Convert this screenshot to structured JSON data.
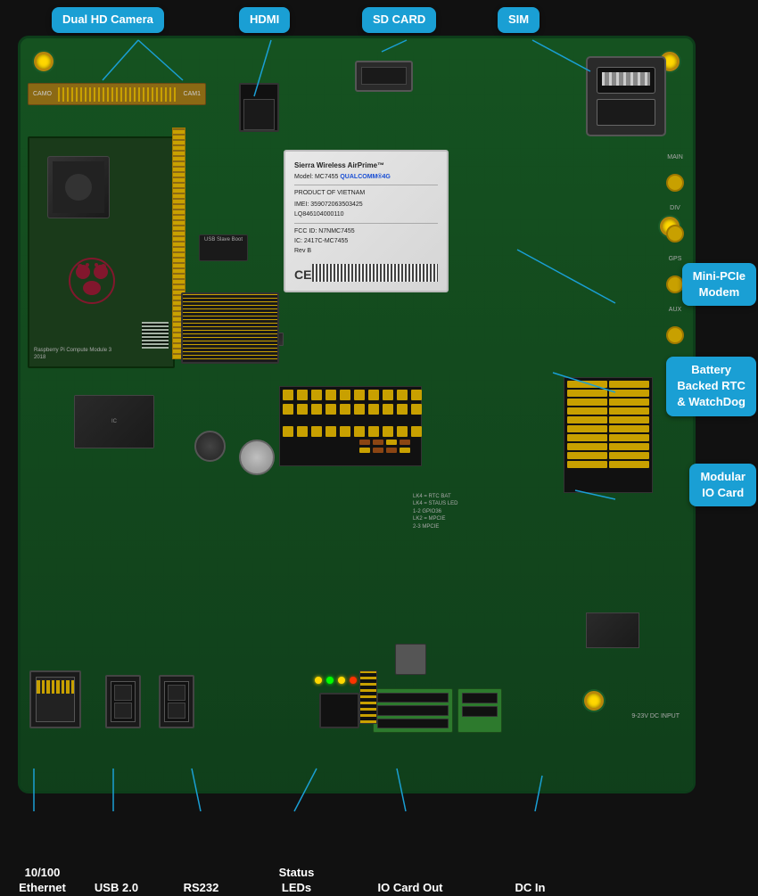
{
  "labels": {
    "dual_hd_camera": "Dual HD Camera",
    "hdmi": "HDMI",
    "sd_card": "SD CARD",
    "sim": "SIM",
    "mini_pcie_modem": "Mini-PCIe\nModem",
    "battery_backed_rtc": "Battery\nBacked RTC\n& WatchDog",
    "modular_io_card": "Modular\nIO Card",
    "ethernet": "10/100\nEthernet",
    "usb20": "USB 2.0",
    "rs232": "RS232",
    "status_leds": "Status\nLEDs",
    "io_card_out": "IO Card Out",
    "dc_in": "DC In"
  },
  "modem": {
    "brand": "Sierra Wireless AirPrime™",
    "model": "Model: MC7455",
    "qualcomm": "QUALCOMM®4G",
    "origin": "PRODUCT OF VIETNAM",
    "imei": "IMEI: 359072063503425",
    "lq": "LQ846104000110",
    "fcc": "FCC ID: N7NMC7455",
    "ic": "IC: 2417C-MC7455",
    "rev": "Rev B"
  },
  "colors": {
    "label_bubble": "#1a9fd4",
    "pcb": "#1a5c2a",
    "mounting_hole": "#ffd700",
    "line": "#1a9fd4"
  }
}
